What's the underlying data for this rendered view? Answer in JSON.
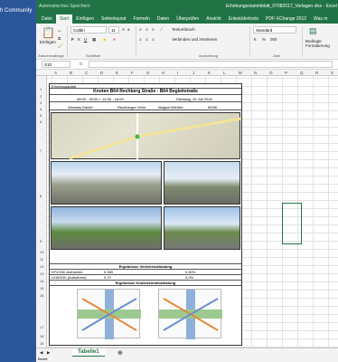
{
  "taskbar": {
    "label": "h Community"
  },
  "window": {
    "title": "Erhebungsstammblatt_07082017_Vorlagen.xlsx  -  Excel",
    "qat_label": "Automatisches Speichern"
  },
  "tabs": [
    "Datei",
    "Start",
    "Einfügen",
    "Seitenlayout",
    "Formeln",
    "Daten",
    "Überprüfen",
    "Ansicht",
    "Entwicklertools",
    "PDF-XChange 2012",
    "Was m"
  ],
  "ribbon": {
    "paste_label": "Einfügen",
    "font_name": "Calibri",
    "font_size": "11",
    "wrap_text": "Textumbruch",
    "merge_center": "Verbinden und zentrieren",
    "number_format": "Standard",
    "conditional": "Bedingte Formatierung",
    "groups": [
      "Zwischenablage",
      "Schriftart",
      "Ausrichtung",
      "Zahl"
    ]
  },
  "formula": {
    "name_box": "S10",
    "fx": "fx"
  },
  "columns": [
    "A",
    "B",
    "C",
    "D",
    "E",
    "F",
    "G",
    "H",
    "I",
    "J",
    "K",
    "L",
    "M",
    "N",
    "O",
    "P",
    "Q",
    "R",
    "S",
    "T"
  ],
  "rows": [
    "1",
    "2",
    "3",
    "4",
    "5",
    "6",
    "7",
    "8",
    "9",
    "10",
    "11",
    "12",
    "13",
    "14",
    "15",
    "16",
    "17",
    "18",
    "19",
    "20"
  ],
  "doc": {
    "header": "Erhebungsblatt",
    "location": "Knoten B64 Rechberg Straße - B64 Begleitstraße",
    "time_label": "08:00 - 09:00 + 15:00 - 16:00",
    "date": "Dienstag, 25 Juli 2016",
    "person": "Wessely Daniel",
    "company": "Rechberger Verst",
    "city": "Wagner/Weißer",
    "code": "80/56",
    "results_title": "Ergebnisse Verkehrsbelastung",
    "row1_label": "KFZ/24h Aufnahme",
    "row1_val": "5.385",
    "row1_pct": "9,50%",
    "row2_label": "LKW/24h (Aufnahme)",
    "row2_val": "0,70",
    "row2_pct": "0,0%",
    "flow_title": "Ergebnisse Knotenstrombelastung"
  },
  "sheet": {
    "tab_label": "Tabelle1"
  },
  "status": {
    "label": "Bereit"
  }
}
